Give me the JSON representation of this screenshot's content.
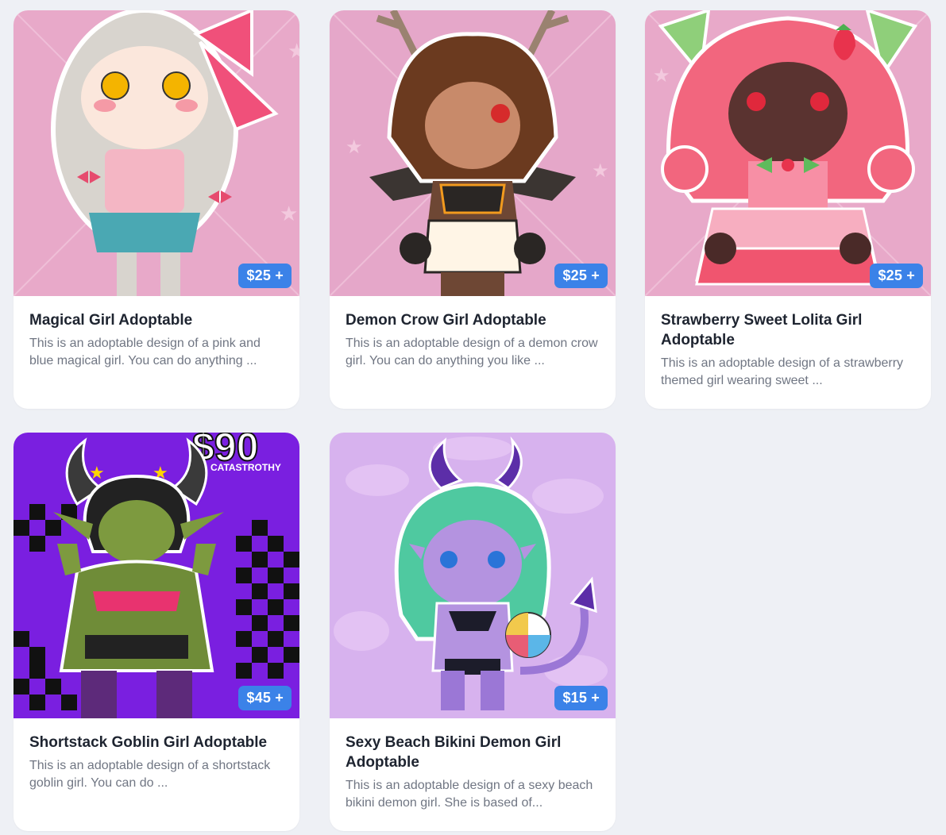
{
  "products": [
    {
      "title": "Magical Girl Adoptable",
      "description": "This is an adoptable design of a pink and blue magical girl. You can do anything ...",
      "price": "$25 +",
      "image": "magical-girl-art",
      "bg_color": "#e8a9c9"
    },
    {
      "title": "Demon Crow Girl Adoptable",
      "description": "This is an adoptable design of a demon crow girl. You can do anything you like ...",
      "price": "$25 +",
      "image": "demon-crow-girl-art",
      "bg_color": "#e5a7c9"
    },
    {
      "title": "Strawberry Sweet Lolita Girl Adoptable",
      "description": "This is an adoptable design of a strawberry themed girl wearing sweet ...",
      "price": "$25 +",
      "image": "strawberry-girl-art",
      "bg_color": "#e8a9c9"
    },
    {
      "title": "Shortstack Goblin Girl Adoptable",
      "description": "This is an adoptable design of a shortstack goblin girl. You can do ...",
      "price": "$45 +",
      "image": "goblin-girl-art",
      "bg_color": "#7a1fe0",
      "art_text": "$90",
      "art_watermark": "CATASTROTHY"
    },
    {
      "title": "Sexy Beach Bikini Demon Girl Adoptable",
      "description": "This is an adoptable design of a sexy beach bikini demon girl. She is based of...",
      "price": "$15 +",
      "image": "beach-demon-girl-art",
      "bg_color": "#d7b2ee"
    }
  ],
  "colors": {
    "page_bg": "#eef0f5",
    "price_badge": "#3b82e8",
    "title_text": "#1e2430",
    "desc_text": "#707683"
  }
}
